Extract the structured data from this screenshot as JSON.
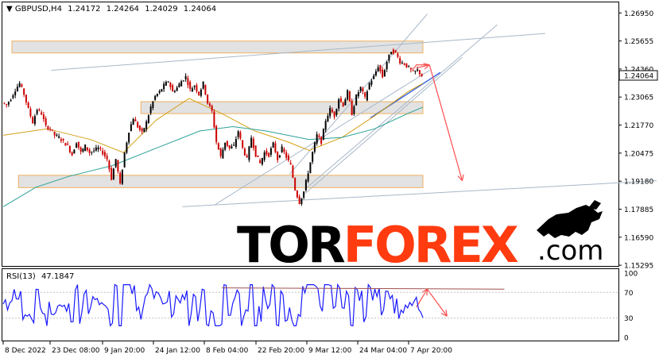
{
  "chart_data": [
    {
      "type": "candlestick",
      "symbol": "GBPUSD,H4",
      "ohlc": {
        "open": "1.24172",
        "high": "1.24264",
        "low": "1.24029",
        "close": "1.24064"
      },
      "current_price": "1.24064",
      "price_axis": {
        "ticks": [
          "1.26950",
          "1.25655",
          "1.24360",
          "1.23065",
          "1.21770",
          "1.20475",
          "1.19180",
          "1.17885",
          "1.16590",
          "1.15295"
        ],
        "ylim": [
          1.153,
          1.274
        ]
      },
      "time_axis": {
        "labels": [
          "8 Dec 2022",
          "23 Dec 08:00",
          "9 Jan 20:00",
          "24 Jan 12:00",
          "8 Feb 04:00",
          "22 Feb 20:00",
          "9 Mar 12:00",
          "24 Mar 04:00",
          "7 Apr 20:00"
        ]
      },
      "price_path": [
        [
          0,
          1.228
        ],
        [
          2,
          1.227
        ],
        [
          4,
          1.23
        ],
        [
          6,
          1.234
        ],
        [
          8,
          1.237
        ],
        [
          10,
          1.232
        ],
        [
          12,
          1.225
        ],
        [
          14,
          1.219
        ],
        [
          16,
          1.225
        ],
        [
          18,
          1.223
        ],
        [
          20,
          1.217
        ],
        [
          22,
          1.216
        ],
        [
          24,
          1.213
        ],
        [
          26,
          1.212
        ],
        [
          28,
          1.21
        ],
        [
          30,
          1.208
        ],
        [
          32,
          1.204
        ],
        [
          34,
          1.21
        ],
        [
          36,
          1.205
        ],
        [
          38,
          1.208
        ],
        [
          40,
          1.205
        ],
        [
          42,
          1.206
        ],
        [
          44,
          1.207
        ],
        [
          46,
          1.205
        ],
        [
          48,
          1.202
        ],
        [
          50,
          1.193
        ],
        [
          52,
          1.202
        ],
        [
          54,
          1.19
        ],
        [
          56,
          1.205
        ],
        [
          58,
          1.215
        ],
        [
          60,
          1.221
        ],
        [
          62,
          1.217
        ],
        [
          64,
          1.214
        ],
        [
          66,
          1.219
        ],
        [
          68,
          1.226
        ],
        [
          70,
          1.231
        ],
        [
          72,
          1.233
        ],
        [
          74,
          1.236
        ],
        [
          76,
          1.238
        ],
        [
          78,
          1.233
        ],
        [
          80,
          1.235
        ],
        [
          82,
          1.238
        ],
        [
          84,
          1.24
        ],
        [
          86,
          1.234
        ],
        [
          88,
          1.236
        ],
        [
          90,
          1.232
        ],
        [
          92,
          1.237
        ],
        [
          94,
          1.228
        ],
        [
          96,
          1.224
        ],
        [
          98,
          1.21
        ],
        [
          100,
          1.203
        ],
        [
          102,
          1.21
        ],
        [
          104,
          1.207
        ],
        [
          106,
          1.208
        ],
        [
          108,
          1.215
        ],
        [
          110,
          1.207
        ],
        [
          112,
          1.202
        ],
        [
          114,
          1.212
        ],
        [
          116,
          1.204
        ],
        [
          118,
          1.2
        ],
        [
          120,
          1.205
        ],
        [
          122,
          1.204
        ],
        [
          124,
          1.209
        ],
        [
          126,
          1.202
        ],
        [
          128,
          1.207
        ],
        [
          130,
          1.203
        ],
        [
          132,
          1.199
        ],
        [
          134,
          1.188
        ],
        [
          136,
          1.182
        ],
        [
          138,
          1.187
        ],
        [
          140,
          1.196
        ],
        [
          142,
          1.205
        ],
        [
          144,
          1.213
        ],
        [
          146,
          1.21
        ],
        [
          148,
          1.22
        ],
        [
          150,
          1.225
        ],
        [
          152,
          1.222
        ],
        [
          154,
          1.23
        ],
        [
          156,
          1.227
        ],
        [
          158,
          1.233
        ],
        [
          160,
          1.223
        ],
        [
          162,
          1.231
        ],
        [
          164,
          1.235
        ],
        [
          166,
          1.23
        ],
        [
          168,
          1.237
        ],
        [
          170,
          1.24
        ],
        [
          172,
          1.245
        ],
        [
          174,
          1.24
        ],
        [
          176,
          1.247
        ],
        [
          178,
          1.252
        ],
        [
          180,
          1.251
        ],
        [
          182,
          1.247
        ],
        [
          184,
          1.246
        ],
        [
          186,
          1.244
        ],
        [
          188,
          1.242
        ],
        [
          190,
          1.243
        ],
        [
          192,
          1.2406
        ]
      ],
      "moving_averages": [
        {
          "color": "#d4a017",
          "values": [
            [
              0,
              1.213
            ],
            [
              20,
              1.216
            ],
            [
              40,
              1.211
            ],
            [
              55,
              1.205
            ],
            [
              70,
              1.22
            ],
            [
              85,
              1.23
            ],
            [
              100,
              1.223
            ],
            [
              115,
              1.215
            ],
            [
              130,
              1.21
            ],
            [
              140,
              1.206
            ],
            [
              155,
              1.212
            ],
            [
              170,
              1.222
            ],
            [
              185,
              1.233
            ],
            [
              192,
              1.237
            ]
          ]
        },
        {
          "color": "#2aa198",
          "values": [
            [
              0,
              1.18
            ],
            [
              15,
              1.189
            ],
            [
              30,
              1.194
            ],
            [
              50,
              1.199
            ],
            [
              70,
              1.207
            ],
            [
              90,
              1.215
            ],
            [
              105,
              1.217
            ],
            [
              120,
              1.215
            ],
            [
              140,
              1.211
            ],
            [
              155,
              1.212
            ],
            [
              170,
              1.216
            ],
            [
              185,
              1.223
            ],
            [
              192,
              1.226
            ]
          ]
        }
      ],
      "zones": [
        {
          "y_range": [
            1.251,
            1.2565
          ],
          "x_range": [
            4,
            192
          ]
        },
        {
          "y_range": [
            1.223,
            1.2285
          ],
          "x_range": [
            63,
            192
          ]
        },
        {
          "y_range": [
            1.1888,
            1.1945
          ],
          "x_range": [
            7,
            192
          ]
        }
      ],
      "forecast_arrows": [
        {
          "from": [
            188,
            1.244
          ],
          "to": [
            186,
            1.246
          ]
        },
        {
          "from": [
            189,
            1.244
          ],
          "to": [
            194,
            1.235
          ]
        },
        {
          "from": [
            194,
            1.235
          ],
          "to": [
            196,
            1.193
          ]
        }
      ],
      "colors": {
        "bull": "#000000",
        "bear": "#cc0000",
        "zone_fill": "#e2e2e2",
        "zone_border": "#f0b060",
        "arrow": "#ff4d4d",
        "trend_line": "#a8b8c8",
        "support": "#4169e1"
      }
    },
    {
      "type": "line",
      "indicator": "RSI(13)",
      "value": "47.1847",
      "ylim": [
        0,
        100
      ],
      "levels": [
        "100",
        "70",
        "30",
        "0"
      ],
      "line_color": "#1a1aff",
      "resistance_line": [
        [
          100,
          77
        ],
        [
          194,
          75
        ]
      ],
      "forecast_arrows": [
        {
          "from": [
            188,
            47
          ],
          "to": [
            190,
            75
          ]
        },
        {
          "from": [
            190,
            75
          ],
          "to": [
            196,
            35
          ]
        }
      ]
    }
  ],
  "watermark": {
    "part1": "TOR",
    "part2": "FOREX",
    "suffix": ".com",
    "colors": {
      "tor": "#000000",
      "forex": "#ff3b0f",
      "com": "#000000"
    }
  }
}
